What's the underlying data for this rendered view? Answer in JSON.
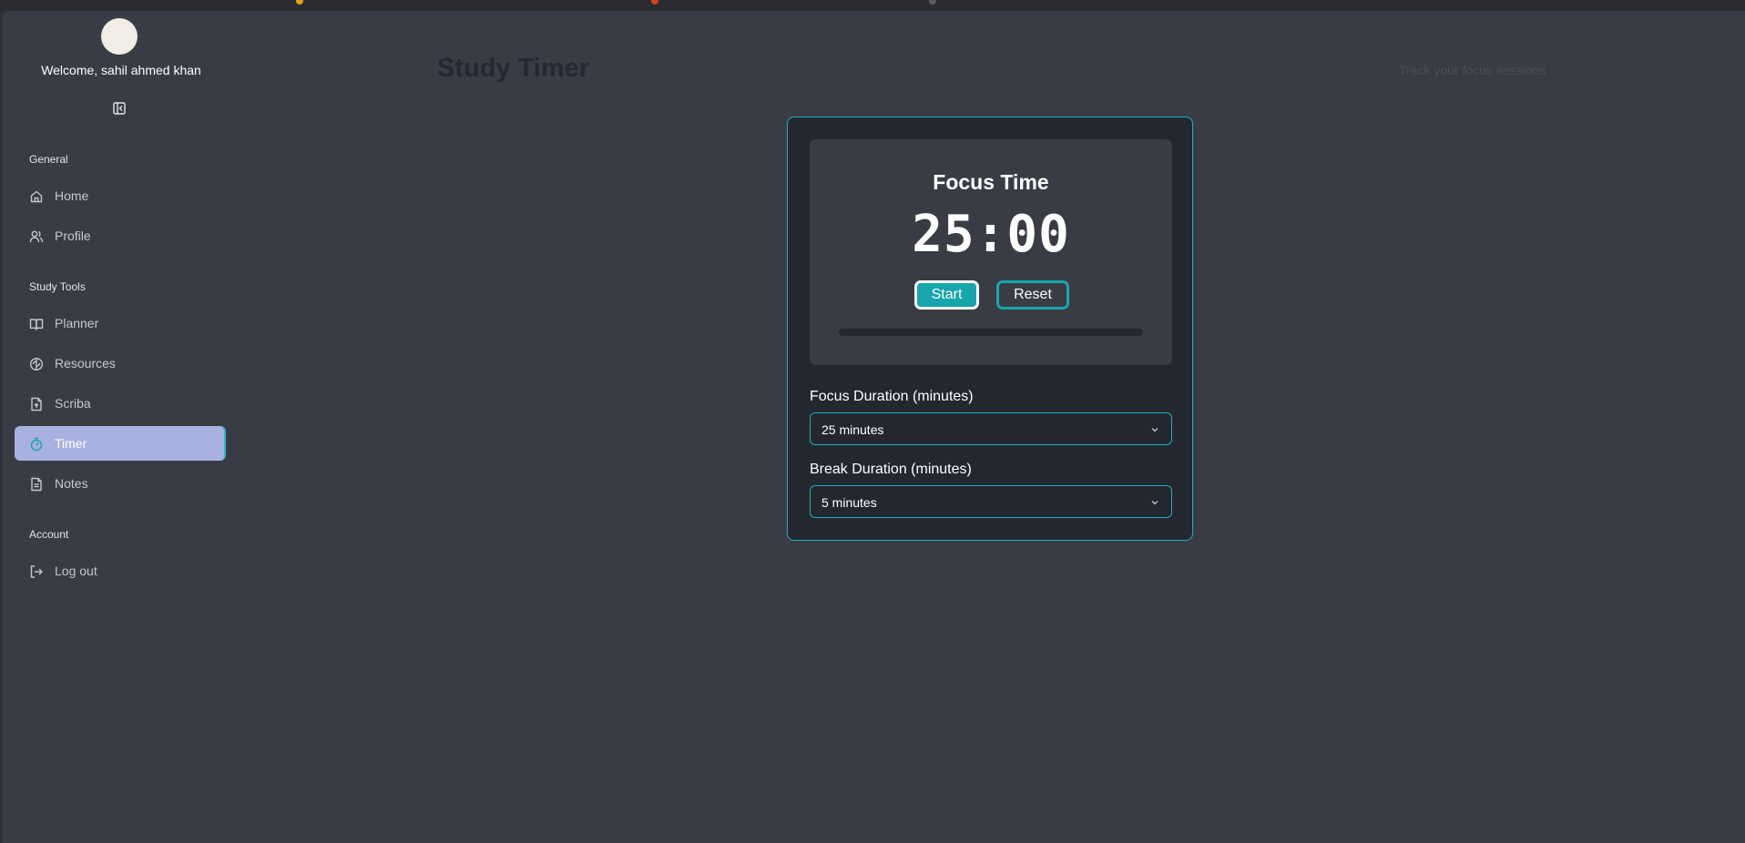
{
  "sidebar": {
    "welcome": "Welcome, sahil ahmed khan",
    "groups": [
      {
        "label": "General"
      },
      {
        "label": "Study Tools"
      },
      {
        "label": "Account"
      }
    ],
    "items": [
      {
        "label": "Home",
        "icon": "home-icon"
      },
      {
        "label": "Profile",
        "icon": "users-icon"
      },
      {
        "label": "Planner",
        "icon": "book-open-icon"
      },
      {
        "label": "Resources",
        "icon": "brain-icon"
      },
      {
        "label": "Scriba",
        "icon": "file-upload-icon"
      },
      {
        "label": "Timer",
        "icon": "timer-icon",
        "active": true
      },
      {
        "label": "Notes",
        "icon": "notes-icon"
      },
      {
        "label": "Log out",
        "icon": "logout-icon"
      }
    ]
  },
  "header": {
    "title": "Study Timer",
    "subtitle": "Track your focus sessions"
  },
  "timer": {
    "mode_title": "Focus Time",
    "display": "25:00",
    "start_label": "Start",
    "reset_label": "Reset",
    "progress": 0
  },
  "settings": {
    "focus_label": "Focus Duration (minutes)",
    "focus_value": "25 minutes",
    "break_label": "Break Duration (minutes)",
    "break_value": "5 minutes"
  },
  "colors": {
    "accent": "#17a6ad",
    "active_nav": "#a9b1e0",
    "background": "#393c45",
    "card": "#232730"
  }
}
